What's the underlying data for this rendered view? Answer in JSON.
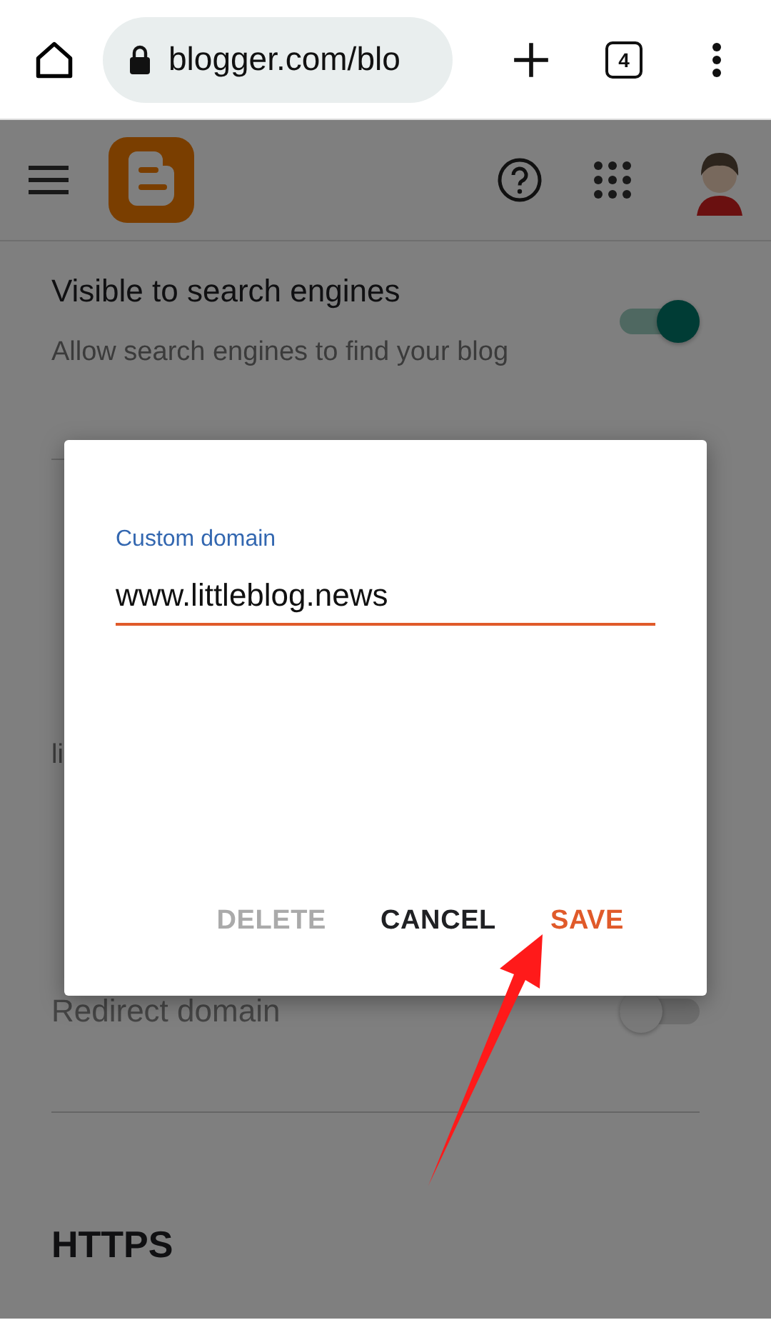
{
  "browser": {
    "url": "blogger.com/blo",
    "tab_count": "4"
  },
  "settings": [
    {
      "kind": "toggle",
      "title": "Visible to search engines",
      "subtitle": "Allow search engines to find your blog",
      "on": true,
      "disabled": false
    },
    {
      "kind": "subtitle",
      "text": "li"
    },
    {
      "kind": "toggle",
      "title": "Redirect domain",
      "on": false,
      "disabled": true
    },
    {
      "kind": "heading",
      "text": "HTTPS"
    }
  ],
  "dialog": {
    "field": {
      "label": "Custom domain",
      "value": "www.littleblog.news"
    },
    "buttons": [
      {
        "label": "DELETE",
        "disabled": true,
        "primary": false
      },
      {
        "label": "CANCEL",
        "disabled": false,
        "primary": false
      },
      {
        "label": "SAVE",
        "disabled": false,
        "primary": true
      }
    ]
  }
}
